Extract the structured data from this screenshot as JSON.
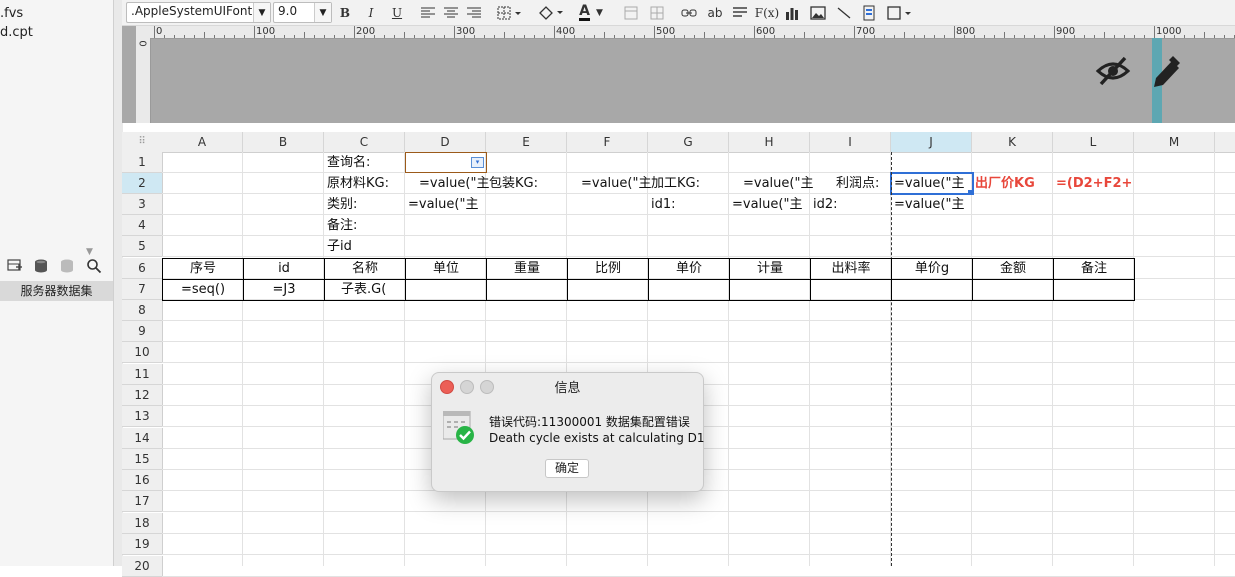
{
  "left_panel": {
    "files": [
      ".fvs",
      "d.cpt"
    ],
    "dataset_label": "服务器数据集",
    "tool_icons": [
      "add-dataset-icon",
      "database-icon",
      "database-disabled-icon",
      "search-icon"
    ]
  },
  "toolbar": {
    "font_name": ".AppleSystemUIFont",
    "font_size": "9.0",
    "bold": "B",
    "italic": "I",
    "underline": "U",
    "text_color_label": "A",
    "text_label": "ab",
    "formula_label": "F(x)"
  },
  "ruler": {
    "top_labels": [
      "0",
      "100",
      "200",
      "300",
      "400",
      "500",
      "600",
      "700",
      "800",
      "900",
      "1000"
    ],
    "left_label": "0"
  },
  "columns": [
    "A",
    "B",
    "C",
    "D",
    "E",
    "F",
    "G",
    "H",
    "I",
    "J",
    "K",
    "L",
    "M"
  ],
  "rows": [
    "1",
    "2",
    "3",
    "4",
    "5",
    "6",
    "7",
    "8",
    "9",
    "10",
    "11",
    "12",
    "13",
    "14",
    "15",
    "16",
    "17",
    "18",
    "19",
    "20"
  ],
  "cells": {
    "C1": "查询名:",
    "C2": "原材料KG:",
    "D2": "=value(\"主",
    "E2": "包装KG:",
    "F2": "=value(\"主",
    "G2": "加工KG:",
    "H2": "=value(\"主",
    "I2": "利润点:",
    "J2": "=value(\"主",
    "K2": "出厂价KG",
    "L2": "=(D2+F2+",
    "C3": "类别:",
    "D3": "=value(\"主",
    "G3": "id1:",
    "H3": "=value(\"主",
    "I3": "id2:",
    "J3": "=value(\"主",
    "C4": "备注:",
    "C5": "子id",
    "A6": "序号",
    "B6": "id",
    "C6": "名称",
    "D6": "单位",
    "E6": "重量",
    "F6": "比例",
    "G6": "单价",
    "H6": "计量",
    "I6": "出料率",
    "J6": "单价g",
    "K6": "金额",
    "L6": "备注",
    "A7": "=seq()",
    "B7": "=J3",
    "C7": "子表.G("
  },
  "colors": {
    "accent_blue": "#2f6fd6",
    "red_text": "#e8473b",
    "selected_col_header": "#cfe8f3",
    "ok_green": "#28b446"
  },
  "dialog": {
    "title": "信息",
    "line1": "错误代码:11300001 数据集配置错误",
    "line2": "Death cycle exists at calculating D1",
    "ok_label": "确定"
  }
}
